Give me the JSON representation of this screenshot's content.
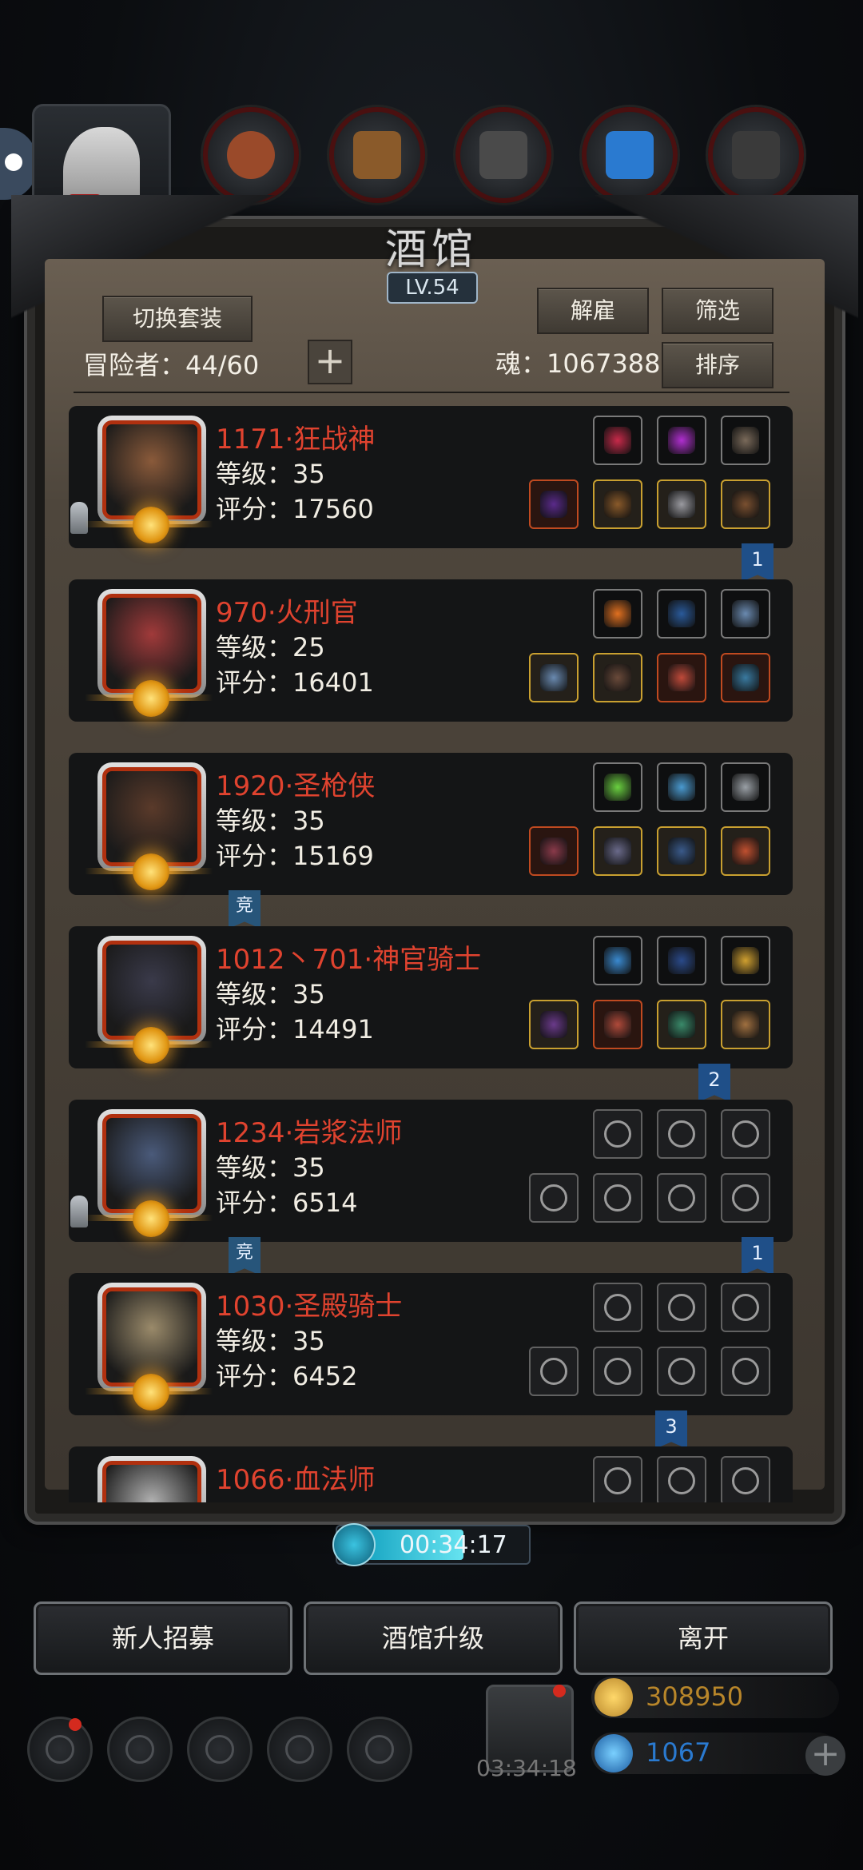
{
  "title": "酒馆",
  "level": "LV.54",
  "header": {
    "switch_set": "切换套装",
    "dismiss": "解雇",
    "filter": "筛选",
    "sort": "排序",
    "adventurers": "冒险者：44/60",
    "plus": "+",
    "soul": "魂：1067388"
  },
  "heroes": [
    {
      "name": "1171·狂战神",
      "level": "等级：35",
      "score": "评分：17560",
      "badge": "1",
      "portrait_color": "#8a5a3a",
      "slots_top": [
        "#c82a4a",
        "#b02fd0",
        "#7a6a5a"
      ],
      "slots_bottom": [
        "#5a2a8a",
        "#8a5a2a",
        "#9a9aa0",
        "#7a5030"
      ],
      "slot_styles_top": [
        "",
        "",
        ""
      ],
      "slot_styles_bottom": [
        "red",
        "gold",
        "gold",
        "gold"
      ]
    },
    {
      "name": "970·火刑官",
      "level": "等级：25",
      "score": "评分：16401",
      "badge": "",
      "portrait_color": "#a03a3a",
      "slots_top": [
        "#e07020",
        "#2a5a9a",
        "#6a8ab0"
      ],
      "slots_bottom": [
        "#6a8ab0",
        "#6a4a3a",
        "#c04a3a",
        "#3a7aa0"
      ],
      "slot_styles_top": [
        "",
        "",
        ""
      ],
      "slot_styles_bottom": [
        "gold",
        "gold",
        "red",
        "red"
      ]
    },
    {
      "name": "1920·圣枪侠",
      "level": "等级：35",
      "score": "评分：15169",
      "badge": "竞",
      "portrait_color": "#5a3a2a",
      "slots_top": [
        "#6ad040",
        "#4a9ad0",
        "#9aa0a6"
      ],
      "slots_bottom": [
        "#8a3a4a",
        "#6a6a8a",
        "#3a5a8a",
        "#c05030"
      ],
      "slot_styles_top": [
        "",
        "",
        ""
      ],
      "slot_styles_bottom": [
        "red",
        "gold",
        "gold",
        "gold"
      ]
    },
    {
      "name": "1012丶701·神官骑士",
      "level": "等级：35",
      "score": "评分：14491",
      "badge": "2",
      "portrait_color": "#3a3a4a",
      "slots_top": [
        "#3a8ad0",
        "#2a4a8a",
        "#d0a030"
      ],
      "slots_bottom": [
        "#6a3a8a",
        "#b04a3a",
        "#3a8a6a",
        "#a07040"
      ],
      "slot_styles_top": [
        "",
        "",
        ""
      ],
      "slot_styles_bottom": [
        "gold",
        "red",
        "gold",
        "gold"
      ]
    },
    {
      "name": "1234·岩浆法师",
      "level": "等级：35",
      "score": "评分：6514",
      "badge": "竞",
      "badge2": "1",
      "portrait_color": "#4a5a7a",
      "slots_top": [
        "",
        "",
        ""
      ],
      "slots_bottom": [
        "",
        "",
        "",
        ""
      ],
      "slot_styles_top": [
        "empty",
        "empty",
        "empty"
      ],
      "slot_styles_bottom": [
        "empty",
        "empty",
        "empty",
        "empty"
      ]
    },
    {
      "name": "1030·圣殿骑士",
      "level": "等级：35",
      "score": "评分：6452",
      "badge": "3",
      "portrait_color": "#9a8a6a",
      "slots_top": [
        "",
        "",
        ""
      ],
      "slots_bottom": [
        "",
        "",
        "",
        ""
      ],
      "slot_styles_top": [
        "empty",
        "empty",
        "empty"
      ],
      "slot_styles_bottom": [
        "empty",
        "empty",
        "empty",
        "empty"
      ]
    },
    {
      "name": "1066·血法师",
      "level": "",
      "score": "",
      "badge": "",
      "portrait_color": "#b0b0b0",
      "slots_top": [
        "",
        "",
        ""
      ],
      "slots_bottom": [],
      "slot_styles_top": [
        "empty",
        "empty",
        "empty"
      ],
      "slot_styles_bottom": []
    }
  ],
  "timer": "00:34:17",
  "buttons": {
    "recruit": "新人招募",
    "upgrade": "酒馆升级",
    "leave": "离开"
  },
  "bottom": {
    "gift_timer": "03:34:18",
    "gold": "308950",
    "gems": "1067",
    "plus": "+"
  },
  "colors": {
    "hero_name": "#e0432f",
    "gold_text": "#b8862a",
    "gem_text": "#2a7ad0"
  }
}
